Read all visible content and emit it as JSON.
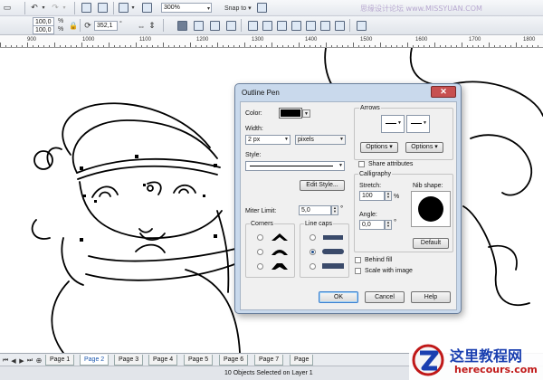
{
  "toolbar_top": {
    "zoom_value": "300%",
    "snap_label": "Snap to",
    "watermark_top": "思缘设计论坛  www.MISSYUAN.COM"
  },
  "property_bar": {
    "scale_x": "100,0",
    "scale_y": "100,0",
    "pct_x": "%",
    "pct_y": "%",
    "rotation": "352,1",
    "rotation_unit": "°"
  },
  "ruler": {
    "labels": [
      "900",
      "1000",
      "1100",
      "1200",
      "1300",
      "1400",
      "1500",
      "1600",
      "1700",
      "1800"
    ]
  },
  "outline_pen": {
    "title": "Outline Pen",
    "close_glyph": "✕",
    "color_label": "Color:",
    "width_label": "Width:",
    "width_value": "2 px",
    "width_unit": "pixels",
    "style_label": "Style:",
    "edit_style_button": "Edit Style...",
    "miter_label": "Miter Limit:",
    "miter_value": "5,0",
    "miter_unit": "°",
    "corners_label": "Corners",
    "line_caps_label": "Line caps",
    "arrows_label": "Arrows",
    "options_left": "Options",
    "options_right": "Options",
    "share_attributes": "Share attributes",
    "calligraphy_label": "Calligraphy",
    "stretch_label": "Stretch:",
    "stretch_value": "100",
    "stretch_unit": "%",
    "nib_shape_label": "Nib shape:",
    "angle_label": "Angle:",
    "angle_value": "0,0",
    "angle_unit": "°",
    "default_button": "Default",
    "behind_fill": "Behind fill",
    "scale_with_image": "Scale with image",
    "ok_button": "OK",
    "cancel_button": "Cancel",
    "help_button": "Help"
  },
  "pages": {
    "tabs": [
      "Page 1",
      "Page 2",
      "Page 3",
      "Page 4",
      "Page 5",
      "Page 6",
      "Page 7",
      "Page"
    ],
    "active_index": 1
  },
  "status": {
    "text": "10 Objects Selected on Layer 1"
  },
  "watermark": {
    "cn": "这里教程网",
    "url": "herecours.com"
  },
  "colors": {
    "outline_color": "#000000",
    "nib": "#000000",
    "dialog_frame": "#c9d9ec",
    "close_button": "#c75050",
    "watermark_cn": "#1a3fb0",
    "watermark_url": "#c01818"
  }
}
